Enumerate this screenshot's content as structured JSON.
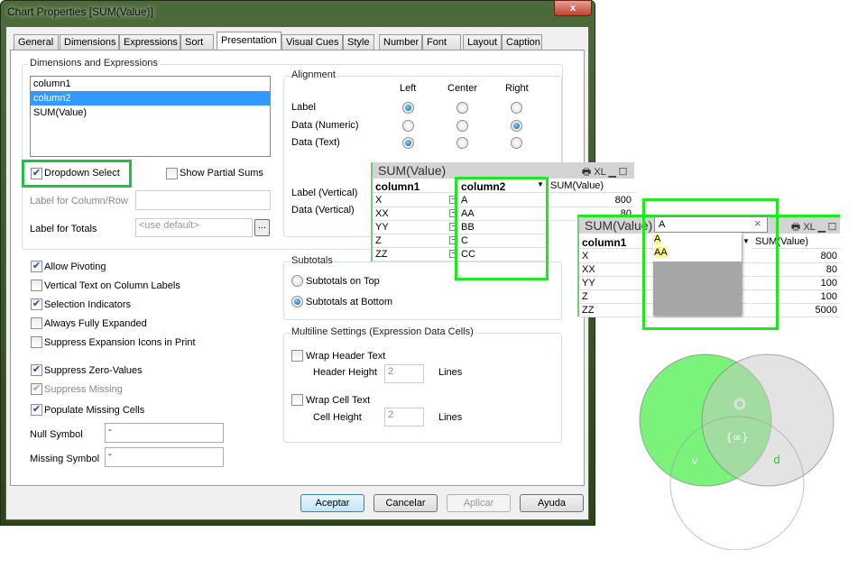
{
  "window": {
    "title": "Chart Properties [SUM(Value)]",
    "close": "x"
  },
  "tabs": [
    "General",
    "Dimensions",
    "Expressions",
    "Sort",
    "Presentation",
    "Visual Cues",
    "Style",
    "Number",
    "Font",
    "Layout",
    "Caption"
  ],
  "active_tab": "Presentation",
  "dims": {
    "group": "Dimensions and Expressions",
    "items": [
      "column1",
      "column2",
      "SUM(Value)"
    ],
    "selected": "column2"
  },
  "dropdown_select": {
    "label": "Dropdown Select",
    "checked": true
  },
  "show_partial_sums": {
    "label": "Show Partial Sums",
    "checked": false
  },
  "label_col_row": {
    "label": "Label for Column/Row",
    "value": ""
  },
  "label_totals": {
    "label": "Label for Totals",
    "placeholder": "<use default>",
    "browse": "..."
  },
  "alignment": {
    "group": "Alignment",
    "cols": [
      "Left",
      "Center",
      "Right"
    ],
    "rows": [
      {
        "label": "Label",
        "sel": "Left"
      },
      {
        "label": "Data (Numeric)",
        "sel": "Right"
      },
      {
        "label": "Data (Text)",
        "sel": "Left"
      }
    ],
    "vertical": [
      "Label (Vertical)",
      "Data (Vertical)"
    ]
  },
  "options": [
    {
      "label": "Allow Pivoting",
      "checked": true
    },
    {
      "label": "Vertical Text on Column Labels",
      "checked": false
    },
    {
      "label": "Selection Indicators",
      "checked": true
    },
    {
      "label": "Always Fully Expanded",
      "checked": false
    },
    {
      "label": "Suppress Expansion Icons in Print",
      "checked": false
    },
    {
      "label": "Suppress Zero-Values",
      "checked": true
    },
    {
      "label": "Suppress Missing",
      "checked": true,
      "disabled": true
    },
    {
      "label": "Populate Missing Cells",
      "checked": true
    }
  ],
  "null_symbol": {
    "label": "Null Symbol",
    "value": "-"
  },
  "missing_symbol": {
    "label": "Missing Symbol",
    "value": "-"
  },
  "subtotals": {
    "group": "Subtotals",
    "top": "Subtotals on Top",
    "bottom": "Subtotals at Bottom",
    "selected": "bottom"
  },
  "multiline": {
    "group": "Multiline Settings (Expression Data Cells)",
    "wrap_header": "Wrap Header Text",
    "header_height": "Header Height",
    "header_value": "2",
    "wrap_cell": "Wrap Cell Text",
    "cell_height": "Cell Height",
    "cell_value": "2",
    "lines": "Lines"
  },
  "buttons": {
    "ok": "Aceptar",
    "cancel": "Cancelar",
    "apply": "Aplicar",
    "help": "Ayuda"
  },
  "table1": {
    "title": "SUM(Value)",
    "headers": [
      "column1",
      "column2",
      "SUM(Value)"
    ],
    "col1": [
      "X",
      "XX",
      "YY",
      "Z",
      "ZZ"
    ],
    "col2": [
      "A",
      "AA",
      "BB",
      "C",
      "CC"
    ],
    "values": [
      "800",
      "80"
    ]
  },
  "table2": {
    "title": "SUM(Value)",
    "search": "A",
    "clear": "×",
    "headers": [
      "column1",
      "SUM(Value)"
    ],
    "col1": [
      "X",
      "XX",
      "YY",
      "Z",
      "ZZ"
    ],
    "values": [
      "800",
      "80",
      "100",
      "100",
      "5000"
    ],
    "matches": [
      "A",
      "AA"
    ]
  },
  "icons": {
    "print": "printer-icon",
    "xl": "XL",
    "min": "minimize-icon",
    "max": "maximize-icon"
  },
  "venn": {
    "labels": [
      "{∞}",
      "v",
      "d"
    ],
    "colors": {
      "a": "#5ef05e",
      "b": "#d8d8d8",
      "c": "#ffffff"
    }
  }
}
